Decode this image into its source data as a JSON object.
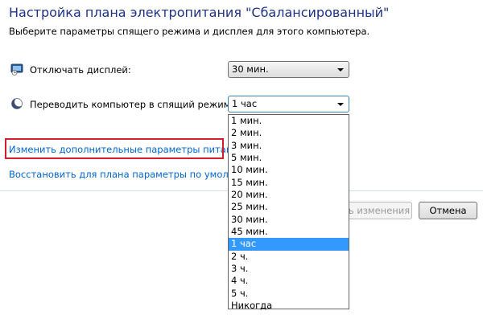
{
  "header": {
    "title": "Настройка плана электропитания \"Сбалансированный\"",
    "subtitle": "Выберите параметры спящего режима и дисплея для этого компьютера."
  },
  "settings": {
    "display_off": {
      "label": "Отключать дисплей:",
      "icon": "monitor-icon",
      "value": "30 мин."
    },
    "sleep": {
      "label": "Переводить компьютер в спящий режим:",
      "icon": "moon-icon",
      "value": "1 час"
    }
  },
  "links": {
    "advanced": "Изменить дополнительные параметры питания",
    "restore": "Восстановить для плана параметры по умолчанию"
  },
  "buttons": {
    "save": "Сохранить изменения",
    "cancel": "Отмена"
  },
  "dropdown": {
    "selected": "1 час",
    "options": [
      "1 мин.",
      "2 мин.",
      "3 мин.",
      "5 мин.",
      "10 мин.",
      "15 мин.",
      "20 мин.",
      "25 мин.",
      "30 мин.",
      "45 мин.",
      "1 час",
      "2 ч.",
      "3 ч.",
      "4 ч.",
      "5 ч.",
      "Никогда"
    ]
  },
  "colors": {
    "title": "#1e3287",
    "link": "#0066cc",
    "highlight_border": "#d0202a",
    "selection": "#3399ff"
  }
}
